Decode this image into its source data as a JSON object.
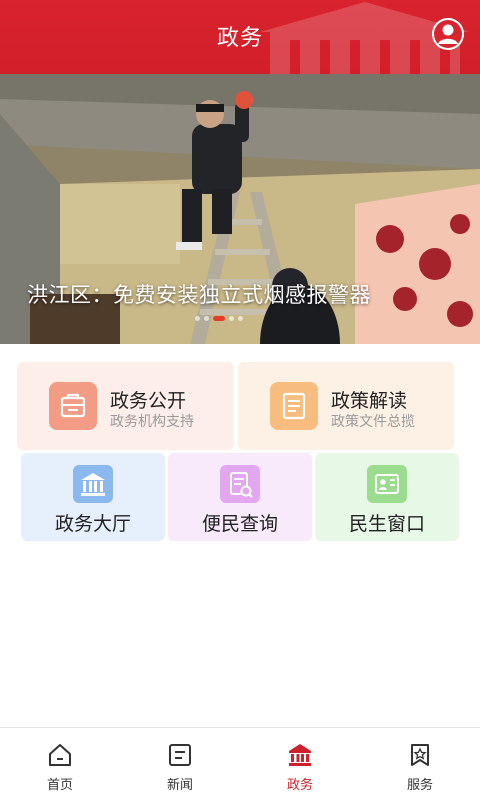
{
  "header": {
    "title": "政务",
    "profile_icon": "user-avatar-icon",
    "background_color": "#d9232e"
  },
  "banner": {
    "caption": "洪江区：免费安装独立式烟感报警器",
    "slide_count": 5,
    "active_slide": 3
  },
  "cards_top": [
    {
      "title": "政务公开",
      "subtitle": "政务机构支持",
      "icon": "briefcase-icon",
      "bg": "#fdeeea",
      "icon_bg": "#f29c86"
    },
    {
      "title": "政策解读",
      "subtitle": "政策文件总揽",
      "icon": "document-icon",
      "bg": "#fdf1e6",
      "icon_bg": "#f7bd7f"
    }
  ],
  "cards_bottom": [
    {
      "title": "政务大厅",
      "icon": "government-building-icon",
      "bg": "#e6f0fd",
      "icon_bg": "#8bb8ef"
    },
    {
      "title": "便民查询",
      "icon": "document-search-icon",
      "bg": "#f8e9fb",
      "icon_bg": "#e3a7ef"
    },
    {
      "title": "民生窗口",
      "icon": "id-card-icon",
      "bg": "#e7f8e6",
      "icon_bg": "#9bdc8e"
    }
  ],
  "tabbar": {
    "items": [
      {
        "label": "首页",
        "icon": "home-icon"
      },
      {
        "label": "新闻",
        "icon": "news-icon"
      },
      {
        "label": "政务",
        "icon": "government-icon"
      },
      {
        "label": "服务",
        "icon": "service-badge-icon"
      }
    ],
    "active_index": 2,
    "active_color": "#d0202b"
  }
}
